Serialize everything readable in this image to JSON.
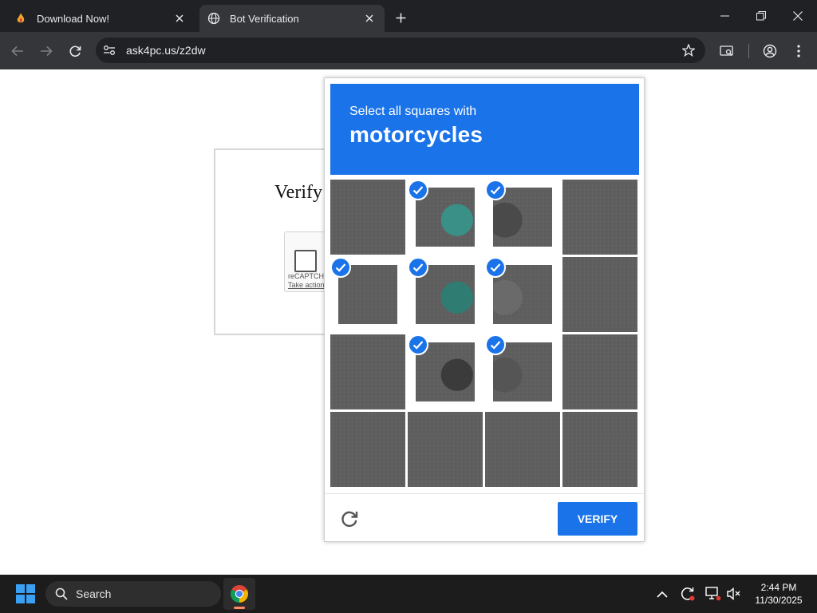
{
  "browser": {
    "tabs": [
      {
        "title": "Download Now!",
        "active": false,
        "favicon": "flame-favicon-icon"
      },
      {
        "title": "Bot Verification",
        "active": true,
        "favicon": "globe-icon"
      }
    ],
    "url": "ask4pc.us/z2dw"
  },
  "page": {
    "heading": "Verify",
    "recaptcha": {
      "brand": "reCAPTCHA",
      "action_link": "Take action"
    }
  },
  "challenge": {
    "instruction": "Select all squares with",
    "target": "motorcycles",
    "grid": {
      "rows": 4,
      "cols": 4,
      "selected": [
        1,
        2,
        4,
        5,
        6,
        9,
        10
      ]
    },
    "verify_label": "VERIFY"
  },
  "taskbar": {
    "search_placeholder": "Search",
    "time": "2:44 PM",
    "date": "11/30/2025"
  },
  "colors": {
    "accent": "#1a73e8",
    "chrome_dark": "#202124",
    "toolbar": "#35363a"
  }
}
